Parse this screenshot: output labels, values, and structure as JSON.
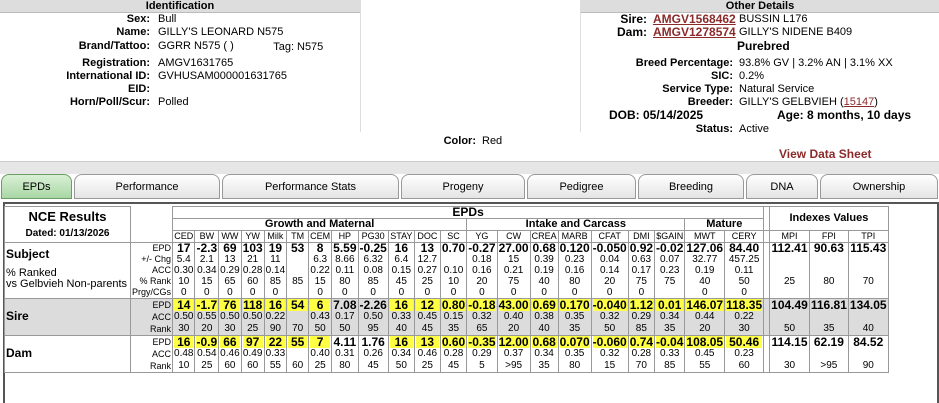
{
  "identification": {
    "title": "Identification",
    "sex_label": "Sex:",
    "sex": "Bull",
    "name_label": "Name:",
    "name": "GILLY'S LEONARD N575",
    "brand_label": "Brand/Tattoo:",
    "brand": "GGRR N575 ( )",
    "tag_label": "Tag:",
    "tag": "N575",
    "reg_label": "Registration:",
    "reg": "AMGV1631765",
    "intl_label": "International ID:",
    "intl": "GVHUSAM000001631765",
    "eid_label": "EID:",
    "eid": "",
    "hps_label": "Horn/Poll/Scur:",
    "hps": "Polled",
    "color_label": "Color:",
    "color": "Red"
  },
  "other": {
    "title": "Other Details",
    "sire_label": "Sire:",
    "sire_id": "AMGV1568462",
    "sire_name": "BUSSIN L176",
    "dam_label": "Dam:",
    "dam_id": "AMGV1278574",
    "dam_name": "GILLY'S NIDENE B409",
    "purebred": "Purebred",
    "breed_label": "Breed Percentage:",
    "breed": "93.8% GV | 3.2% AN | 3.1% XX",
    "sic_label": "SIC:",
    "sic": "0.2%",
    "service_label": "Service Type:",
    "service": "Natural Service",
    "breeder_label": "Breeder:",
    "breeder": "GILLY'S GELBVIEH (",
    "breeder_id": "15147",
    "breeder_close": ")",
    "dob": "DOB: 05/14/2025",
    "age": "Age: 8 months, 10 days",
    "status_label": "Status:",
    "status": "Active"
  },
  "view_data_sheet": "View Data Sheet",
  "tabs": [
    "EPDs",
    "Performance",
    "Performance Stats",
    "Progeny",
    "Pedigree",
    "Breeding",
    "DNA",
    "Ownership"
  ],
  "epd": {
    "nce": "NCE Results",
    "dated": "Dated: 01/13/2026",
    "epds": "EPDs",
    "indexes": "Indexes Values",
    "growth": "Growth and Maternal",
    "intake": "Intake and Carcass",
    "mature": "Mature",
    "cols": [
      "CED",
      "BW",
      "WW",
      "YW",
      "Milk",
      "TM",
      "CEM",
      "HP",
      "PG30",
      "STAY",
      "DOC",
      "SC",
      "YG",
      "CW",
      "CREA",
      "MARB",
      "CFAT",
      "DMI",
      "$GAIN",
      "MWT",
      "CERY",
      "MPI",
      "FPI",
      "TPI"
    ],
    "subject_label": "Subject",
    "ranked_label": "% Ranked",
    "vs_label": "vs Gelbvieh Non-parents",
    "row_labels": [
      "EPD",
      "+/- Chg",
      "ACC",
      "% Rank",
      "Prgy/CGs"
    ],
    "subject": {
      "epd": [
        "17",
        "-2.3",
        "69",
        "103",
        "19",
        "53",
        "8",
        "5.59",
        "-0.25",
        "16",
        "13",
        "0.70",
        "-0.27",
        "27.00",
        "0.68",
        "0.120",
        "-0.050",
        "0.92",
        "-0.02",
        "127.06",
        "84.40",
        "112.41",
        "90.63",
        "115.43"
      ],
      "chg": [
        "5.4",
        "2.1",
        "13",
        "21",
        "11",
        "",
        "6.3",
        "8.66",
        "6.32",
        "6.4",
        "12.7",
        "",
        "0.18",
        "15",
        "0.39",
        "0.23",
        "0.04",
        "0.63",
        "0.07",
        "32.77",
        "457.25",
        "",
        "",
        ""
      ],
      "acc": [
        "0.30",
        "0.34",
        "0.29",
        "0.28",
        "0.14",
        "",
        "0.22",
        "0.11",
        "0.08",
        "0.15",
        "0.27",
        "0.10",
        "0.16",
        "0.21",
        "0.19",
        "0.16",
        "0.14",
        "0.17",
        "0.23",
        "0.19",
        "0.11",
        "",
        "",
        ""
      ],
      "rank": [
        "10",
        "15",
        "65",
        "60",
        "85",
        "85",
        "15",
        "80",
        "85",
        "45",
        "25",
        "10",
        "20",
        "75",
        "40",
        "80",
        "20",
        "75",
        "75",
        "40",
        "50",
        "25",
        "80",
        "70"
      ],
      "prgy": [
        "0",
        "0",
        "0",
        "0",
        "0",
        "",
        "0",
        "0",
        "0",
        "0",
        "0",
        "0",
        "0",
        "0",
        "0",
        "0",
        "0",
        "0",
        "",
        "0",
        "0",
        "",
        "",
        ""
      ]
    },
    "sire_label": "Sire",
    "dam_label": "Dam",
    "sd_labels": [
      "EPD",
      "ACC",
      "Rank"
    ],
    "sire": {
      "epd": [
        "14",
        "-1.7",
        "76",
        "118",
        "16",
        "54",
        "6",
        "7.08",
        "-2.26",
        "16",
        "12",
        "0.80",
        "-0.18",
        "43.00",
        "0.69",
        "0.170",
        "-0.040",
        "1.12",
        "0.01",
        "146.07",
        "118.35",
        "104.49",
        "116.81",
        "134.05"
      ],
      "acc": [
        "0.50",
        "0.55",
        "0.50",
        "0.50",
        "0.22",
        "",
        "0.43",
        "0.17",
        "0.50",
        "0.33",
        "0.45",
        "0.15",
        "0.32",
        "0.40",
        "0.38",
        "0.35",
        "0.32",
        "0.29",
        "0.34",
        "0.44",
        "0.22",
        "",
        "",
        ""
      ],
      "rank": [
        "30",
        "20",
        "30",
        "25",
        "90",
        "70",
        "50",
        "50",
        "95",
        "40",
        "45",
        "35",
        "65",
        "20",
        "40",
        "35",
        "50",
        "85",
        "35",
        "20",
        "30",
        "50",
        "35",
        "40"
      ],
      "hl": [
        true,
        true,
        true,
        true,
        true,
        true,
        true,
        false,
        false,
        true,
        true,
        true,
        true,
        true,
        true,
        true,
        true,
        true,
        true,
        true,
        true,
        false,
        false,
        false
      ]
    },
    "dam": {
      "epd": [
        "16",
        "-0.9",
        "66",
        "97",
        "22",
        "55",
        "7",
        "4.11",
        "1.76",
        "16",
        "13",
        "0.60",
        "-0.35",
        "12.00",
        "0.68",
        "0.070",
        "-0.060",
        "0.74",
        "-0.04",
        "108.05",
        "50.46",
        "114.15",
        "62.19",
        "84.52"
      ],
      "acc": [
        "0.48",
        "0.54",
        "0.46",
        "0.49",
        "0.33",
        "",
        "0.40",
        "0.31",
        "0.26",
        "0.34",
        "0.46",
        "0.28",
        "0.29",
        "0.37",
        "0.34",
        "0.35",
        "0.32",
        "0.28",
        "0.33",
        "0.45",
        "0.23",
        "",
        "",
        ""
      ],
      "rank": [
        "10",
        "25",
        "60",
        "60",
        "55",
        "60",
        "25",
        "80",
        "45",
        "50",
        "25",
        "45",
        "5",
        ">95",
        "35",
        "80",
        "15",
        "70",
        "85",
        "55",
        "60",
        "30",
        ">95",
        "90"
      ],
      "hl": [
        true,
        true,
        true,
        true,
        true,
        true,
        true,
        false,
        false,
        true,
        true,
        true,
        true,
        true,
        true,
        true,
        true,
        true,
        true,
        true,
        true,
        false,
        false,
        false
      ]
    }
  }
}
